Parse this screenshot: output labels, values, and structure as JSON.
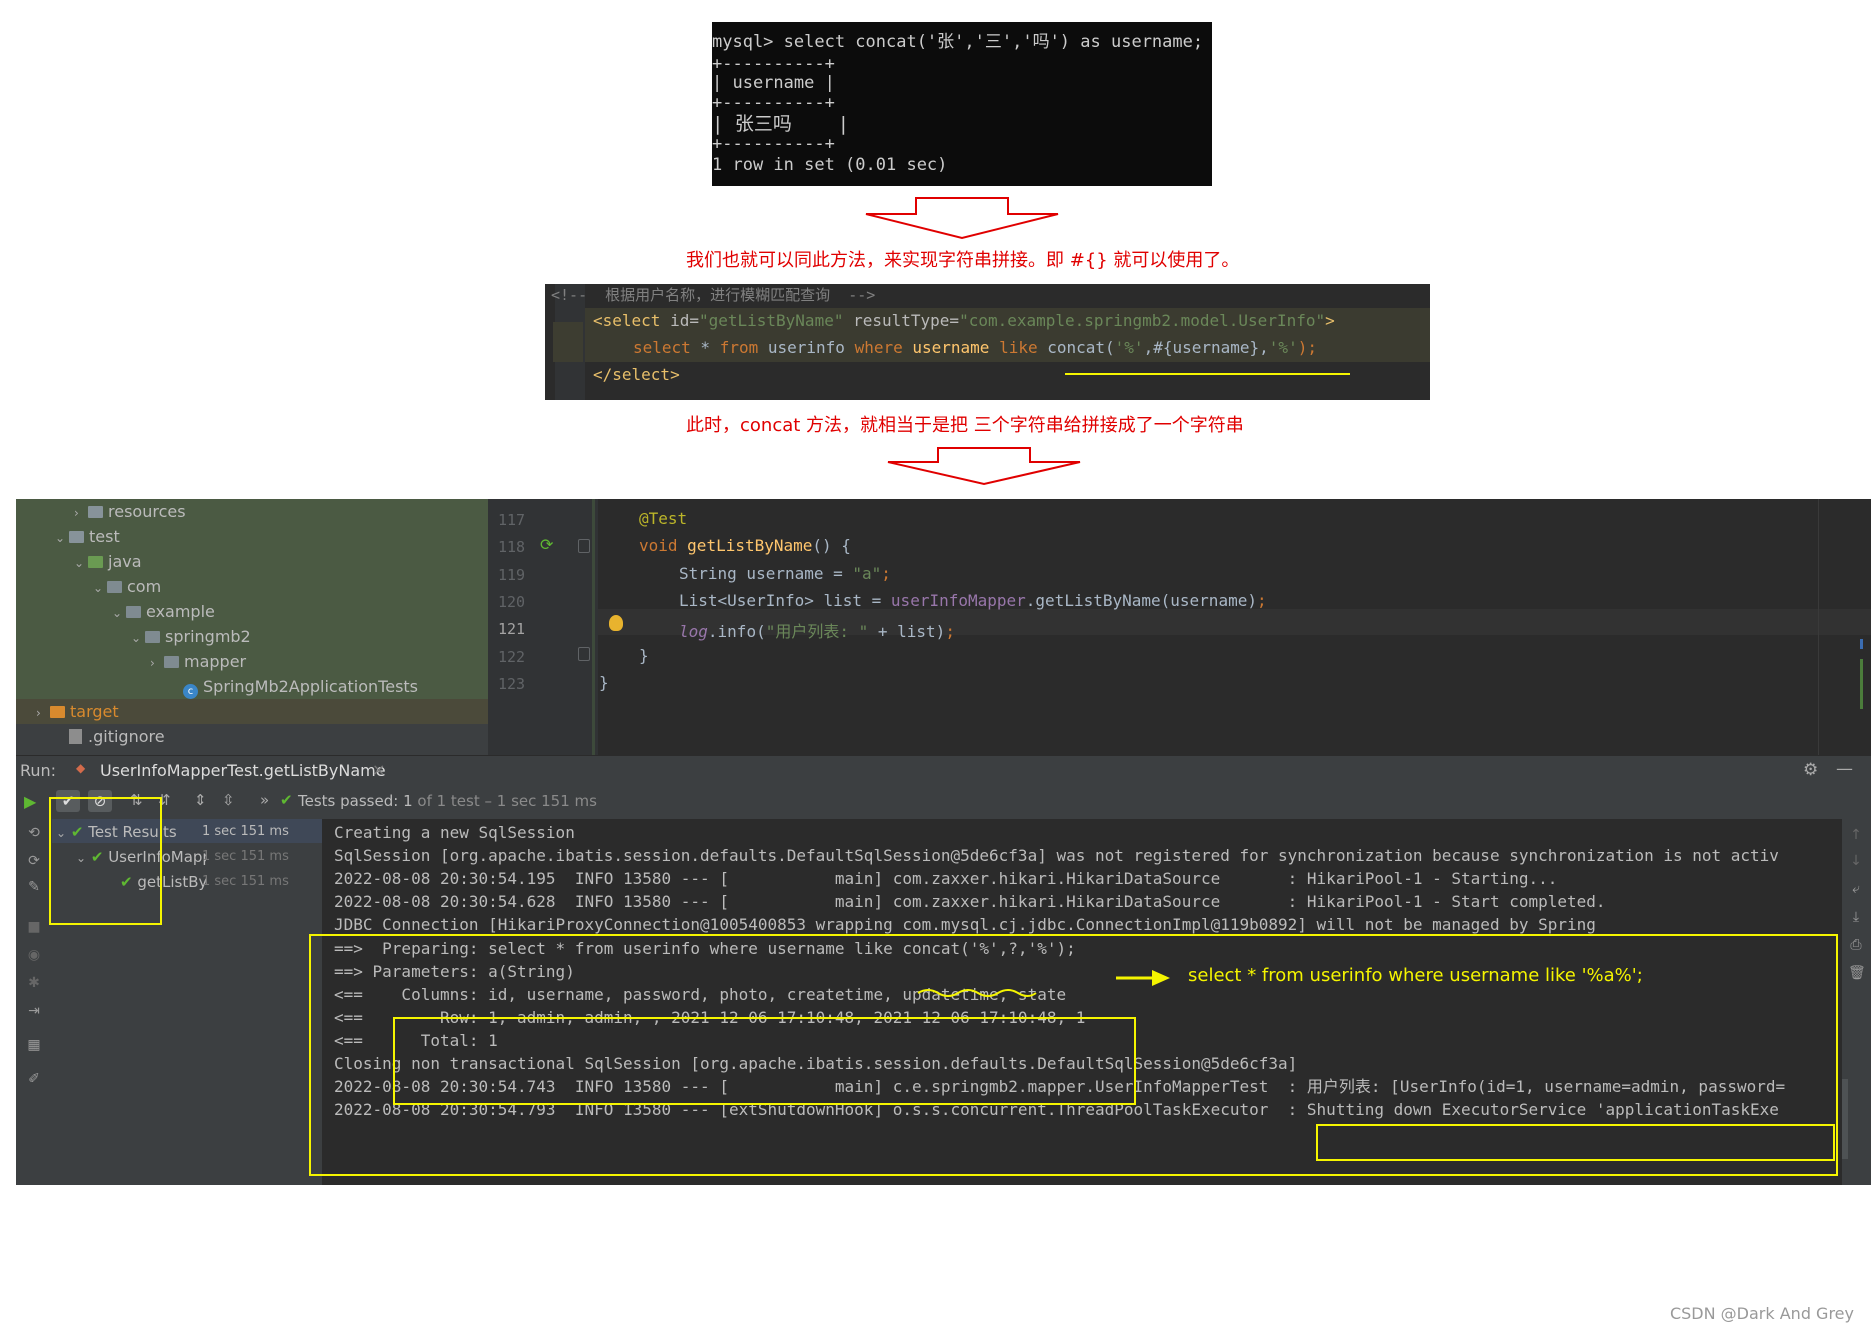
{
  "mysql": {
    "command": "mysql> select concat('张','三','吗') as username;",
    "border": "+----------+",
    "header": "| username |",
    "row": "| 张三吗    |",
    "footer": "1 row in set (0.01 sec)"
  },
  "captions": {
    "first": "我们也就可以同此方法，来实现字符串拼接。即 #{} 就可以使用了。",
    "second": "此时，concat 方法，就相当于是把 三个字符串给拼接成了一个字符串"
  },
  "xml": {
    "comment": "<!--  根据用户名称，进行模糊匹配查询  -->",
    "select_open_tag": "<select",
    "attr_id": " id=",
    "attr_id_val": "\"getListByName\"",
    "attr_result": " resultType=",
    "attr_result_val": "\"com.example.springmb2.model.UserInfo\"",
    "close_gt": ">",
    "sql_kw1": "select",
    "sql_mid1": " * ",
    "sql_kw2": "from",
    "sql_tbl": " userinfo ",
    "sql_kw3": "where",
    "sql_col": " username ",
    "sql_kw4": "like",
    "sql_fn": " concat(",
    "sql_s1": "'%'",
    "sql_comma": ",#{username},",
    "sql_s2": "'%'",
    "sql_end": ");",
    "select_close": "</select>"
  },
  "project_tree": [
    {
      "label": "resources",
      "indent": 3,
      "chev": "›",
      "icon": "folder"
    },
    {
      "label": "test",
      "indent": 2,
      "chev": "⌄",
      "icon": "folder"
    },
    {
      "label": "java",
      "indent": 3,
      "chev": "⌄",
      "icon": "green"
    },
    {
      "label": "com",
      "indent": 4,
      "chev": "⌄",
      "icon": "pkg"
    },
    {
      "label": "example",
      "indent": 5,
      "chev": "⌄",
      "icon": "pkg"
    },
    {
      "label": "springmb2",
      "indent": 6,
      "chev": "⌄",
      "icon": "pkg"
    },
    {
      "label": "mapper",
      "indent": 7,
      "chev": "›",
      "icon": "pkg"
    },
    {
      "label": "SpringMb2ApplicationTests",
      "indent": 8,
      "chev": "",
      "icon": "class"
    },
    {
      "label": "target",
      "indent": 1,
      "chev": "›",
      "icon": "orange"
    },
    {
      "label": ".gitignore",
      "indent": 2,
      "chev": "",
      "icon": "file"
    }
  ],
  "editor": {
    "line_numbers": [
      "117",
      "118",
      "119",
      "120",
      "121",
      "122",
      "123"
    ],
    "l117": "@Test",
    "l118_kw": "void ",
    "l118_fn": "getListByName",
    "l118_rest": "() {",
    "l119_type": "String username = ",
    "l119_str": "\"a\"",
    "l119_end": ";",
    "l120_a": "List<UserInfo> list = ",
    "l120_field": "userInfoMapper",
    "l120_b": ".getListByName(username)",
    "l120_end": ";",
    "l121_log": "log",
    "l121_a": ".info(",
    "l121_str": "\"用户列表: \"",
    "l121_b": " + list)",
    "l121_end": ";",
    "l122": "}",
    "l123": "}"
  },
  "run": {
    "label": "Run:",
    "tab": "UserInfoMapperTest.getListByName",
    "tests_passed": "Tests passed:",
    "tests_count": "1",
    "tests_detail": "of 1 test – 1 sec 151 ms",
    "tree": [
      {
        "label": "Test Results",
        "time": "1 sec 151 ms"
      },
      {
        "label": "UserInfoMapp",
        "time": "1 sec 151 ms"
      },
      {
        "label": "getListByN",
        "time": "1 sec 151 ms"
      }
    ]
  },
  "console_lines": [
    "Creating a new SqlSession",
    "SqlSession [org.apache.ibatis.session.defaults.DefaultSqlSession@5de6cf3a] was not registered for synchronization because synchronization is not activ",
    "2022-08-08 20:30:54.195  INFO 13580 --- [           main] com.zaxxer.hikari.HikariDataSource       : HikariPool-1 - Starting...",
    "2022-08-08 20:30:54.628  INFO 13580 --- [           main] com.zaxxer.hikari.HikariDataSource       : HikariPool-1 - Start completed.",
    "JDBC Connection [HikariProxyConnection@1005400853 wrapping com.mysql.cj.jdbc.ConnectionImpl@119b0892] will not be managed by Spring",
    "==>  Preparing: select * from userinfo where username like concat('%',?,'%');",
    "==> Parameters: a(String)",
    "<==    Columns: id, username, password, photo, createtime, updatetime, state",
    "<==        Row: 1, admin, admin, , 2021-12-06 17:10:48, 2021-12-06 17:10:48, 1",
    "<==      Total: 1",
    "Closing non transactional SqlSession [org.apache.ibatis.session.defaults.DefaultSqlSession@5de6cf3a]",
    "2022-08-08 20:30:54.743  INFO 13580 --- [           main] c.e.springmb2.mapper.UserInfoMapperTest  : 用户列表: [UserInfo(id=1, username=admin, password=",
    "2022-08-08 20:30:54.793  INFO 13580 --- [extShutdownHook] o.s.s.concurrent.ThreadPoolTaskExecutor  : Shutting down ExecutorService 'applicationTaskExe"
  ],
  "annotation": "select * from userinfo where username like '%a%';",
  "watermark": "CSDN @Dark And Grey",
  "colors": {
    "red": "#e00000",
    "yellow": "#f5f500",
    "keyword": "#cc7832",
    "string": "#6a8759",
    "annotation_java": "#bbb529",
    "method": "#ffc66d",
    "field": "#9876aa"
  }
}
